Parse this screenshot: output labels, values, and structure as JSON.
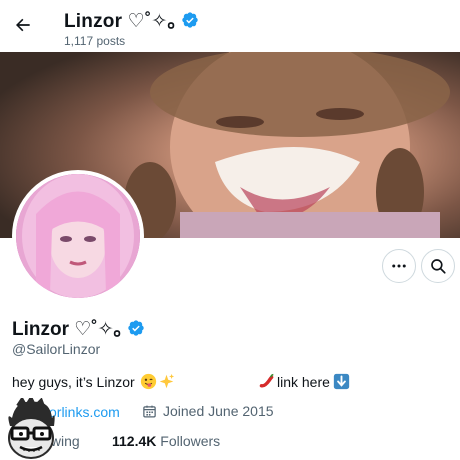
{
  "header": {
    "name": "Linzor ♡˚✧｡",
    "posts_count": "1,117 posts"
  },
  "profile": {
    "display_name": "Linzor ♡˚✧｡",
    "handle": "@SailorLinzor",
    "bio_text": "hey guys, it’s Linzor",
    "bio_link_text": "link here",
    "website": "zorlinks.com",
    "joined": "Joined June 2015",
    "following_label": "lowing",
    "followers_count": "112.4K",
    "followers_label": "Followers"
  },
  "icons": {
    "back": "arrow-left-icon",
    "verified": "verified-badge-icon",
    "more": "more-dots-icon",
    "search": "search-icon",
    "calendar": "calendar-icon"
  },
  "colors": {
    "verified": "#1d9bf0",
    "link": "#1d9bf0",
    "secondary_text": "#536471"
  }
}
